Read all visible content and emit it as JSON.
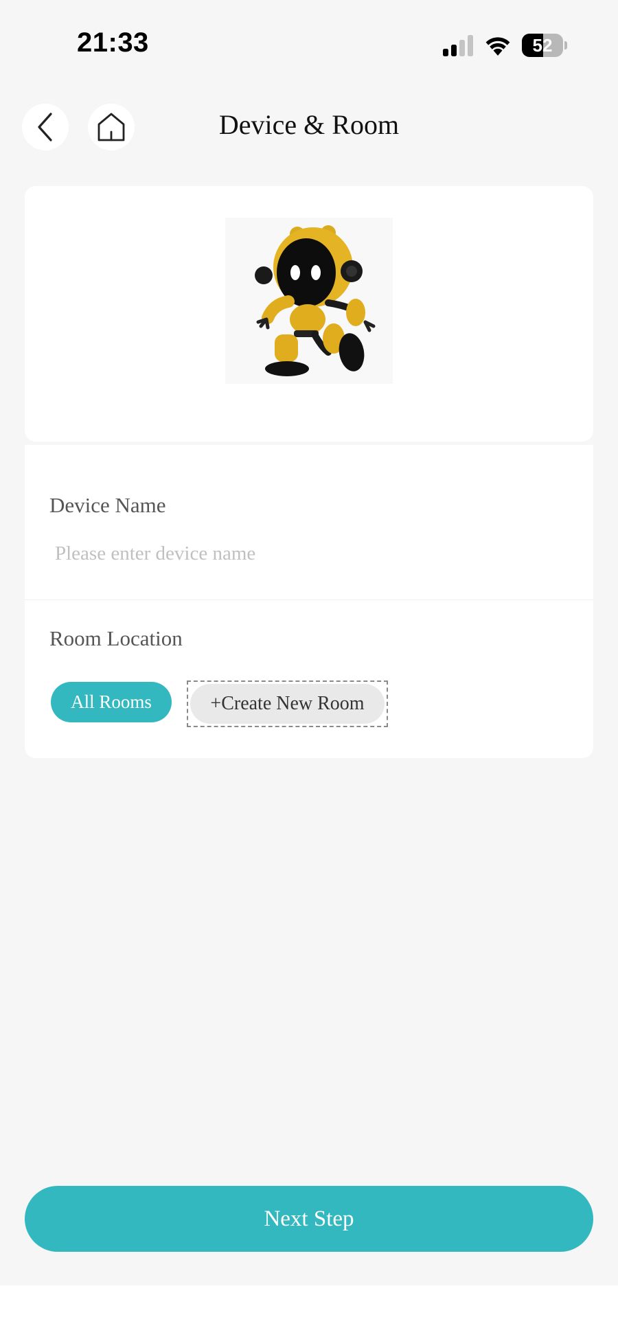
{
  "status_bar": {
    "time": "21:33",
    "battery_level": "52",
    "battery_fraction": 0.52,
    "signal_bars_active": 2,
    "signal_bars_total": 4,
    "icons": [
      "signal-icon",
      "wifi-icon",
      "battery-icon"
    ]
  },
  "header": {
    "title": "Device & Room",
    "back_icon": "chevron-left-icon",
    "home_icon": "home-icon"
  },
  "device_card": {
    "image": "yellow-robot-toy"
  },
  "form": {
    "device_name": {
      "label": "Device Name",
      "value": "",
      "placeholder": "Please enter device name"
    },
    "room_location": {
      "label": "Room Location",
      "rooms": [
        {
          "label": "All Rooms",
          "selected": true
        }
      ],
      "create_room_label": "+Create New Room"
    }
  },
  "footer": {
    "next_label": "Next Step"
  },
  "colors": {
    "accent": "#33b8bf",
    "background": "#f6f6f6",
    "card": "#ffffff"
  }
}
